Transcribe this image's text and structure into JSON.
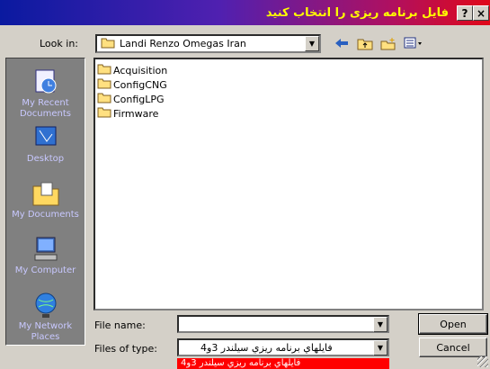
{
  "window": {
    "title": "فایل برنامه ریزی را انتخاب کنید",
    "help_label": "?",
    "close_label": "×"
  },
  "lookin": {
    "label": "Look in:",
    "value": "Landi Renzo Omegas Iran"
  },
  "places": [
    {
      "label": "My Recent Documents",
      "icon": "recent-documents-icon"
    },
    {
      "label": "Desktop",
      "icon": "desktop-icon"
    },
    {
      "label": "My Documents",
      "icon": "my-documents-icon"
    },
    {
      "label": "My Computer",
      "icon": "my-computer-icon"
    },
    {
      "label": "My Network Places",
      "icon": "network-places-icon"
    }
  ],
  "files": [
    {
      "name": "Acquisition"
    },
    {
      "name": "ConfigCNG"
    },
    {
      "name": "ConfigLPG"
    },
    {
      "name": "Firmware"
    }
  ],
  "filename": {
    "label": "File name:",
    "value": ""
  },
  "filetype": {
    "label": "Files of type:",
    "value": "فايلهاي برنامه ريزي سيلندر 3و4",
    "option": "فايلهاي برنامه ريزي سيلندر 3و4"
  },
  "buttons": {
    "open": "Open",
    "cancel": "Cancel"
  },
  "colors": {
    "title_text": "#ffff00",
    "title_start": "#0a1aa0",
    "title_end": "#e00818",
    "places_bg": "#808080",
    "highlight": "#ff0000"
  }
}
